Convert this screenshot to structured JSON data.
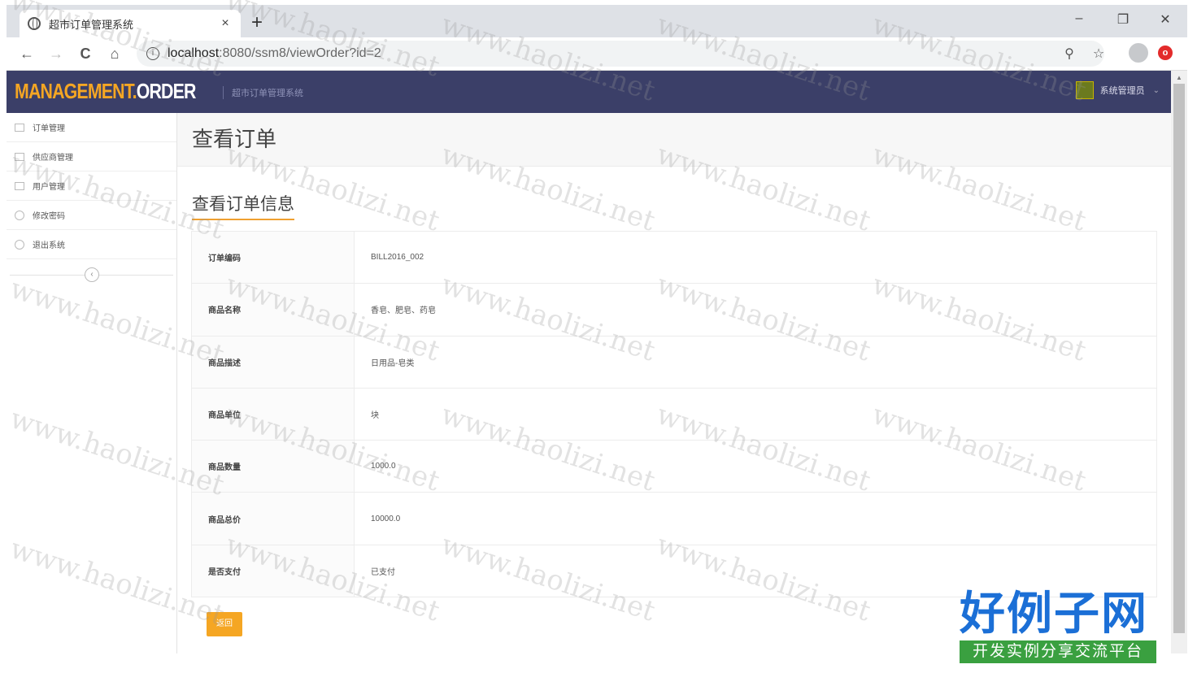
{
  "browser": {
    "tab_title": "超市订单管理系统",
    "tab_close": "×",
    "new_tab": "+",
    "url_host": "localhost",
    "url_path": ":8080/ssm8/viewOrder?id=2",
    "win_min": "–",
    "win_max": "❐",
    "win_close": "✕",
    "back": "←",
    "forward": "→",
    "reload": "C",
    "home": "⌂",
    "zoom_icon": "⚲",
    "star_icon": "☆"
  },
  "app": {
    "logo_part1": "MANAGEMENT.",
    "logo_part2": "ORDER",
    "subtitle": "超市订单管理系统",
    "user_name": "系统管理员",
    "user_caret": "⌄"
  },
  "sidebar": {
    "items": [
      {
        "label": "订单管理"
      },
      {
        "label": "供应商管理"
      },
      {
        "label": "用户管理"
      },
      {
        "label": "修改密码"
      },
      {
        "label": "退出系统"
      }
    ],
    "collapse": "‹"
  },
  "main": {
    "page_title": "查看订单",
    "section_title": "查看订单信息",
    "rows": [
      {
        "key": "订单编码",
        "value": "BILL2016_002"
      },
      {
        "key": "商品名称",
        "value": "香皂、肥皂、药皂"
      },
      {
        "key": "商品描述",
        "value": "日用品-皂类"
      },
      {
        "key": "商品单位",
        "value": "块"
      },
      {
        "key": "商品数量",
        "value": "1000.0"
      },
      {
        "key": "商品总价",
        "value": "10000.0"
      },
      {
        "key": "是否支付",
        "value": "已支付"
      }
    ],
    "back_button": "返回"
  },
  "watermark": "www.haolizi.net",
  "brand": {
    "big": "好例子网",
    "small": "开发实例分享交流平台"
  },
  "colors": {
    "header_bg": "#3b3f68",
    "accent": "#f5a623",
    "brand_blue": "#1b6fd6",
    "brand_green": "#3aa040"
  }
}
